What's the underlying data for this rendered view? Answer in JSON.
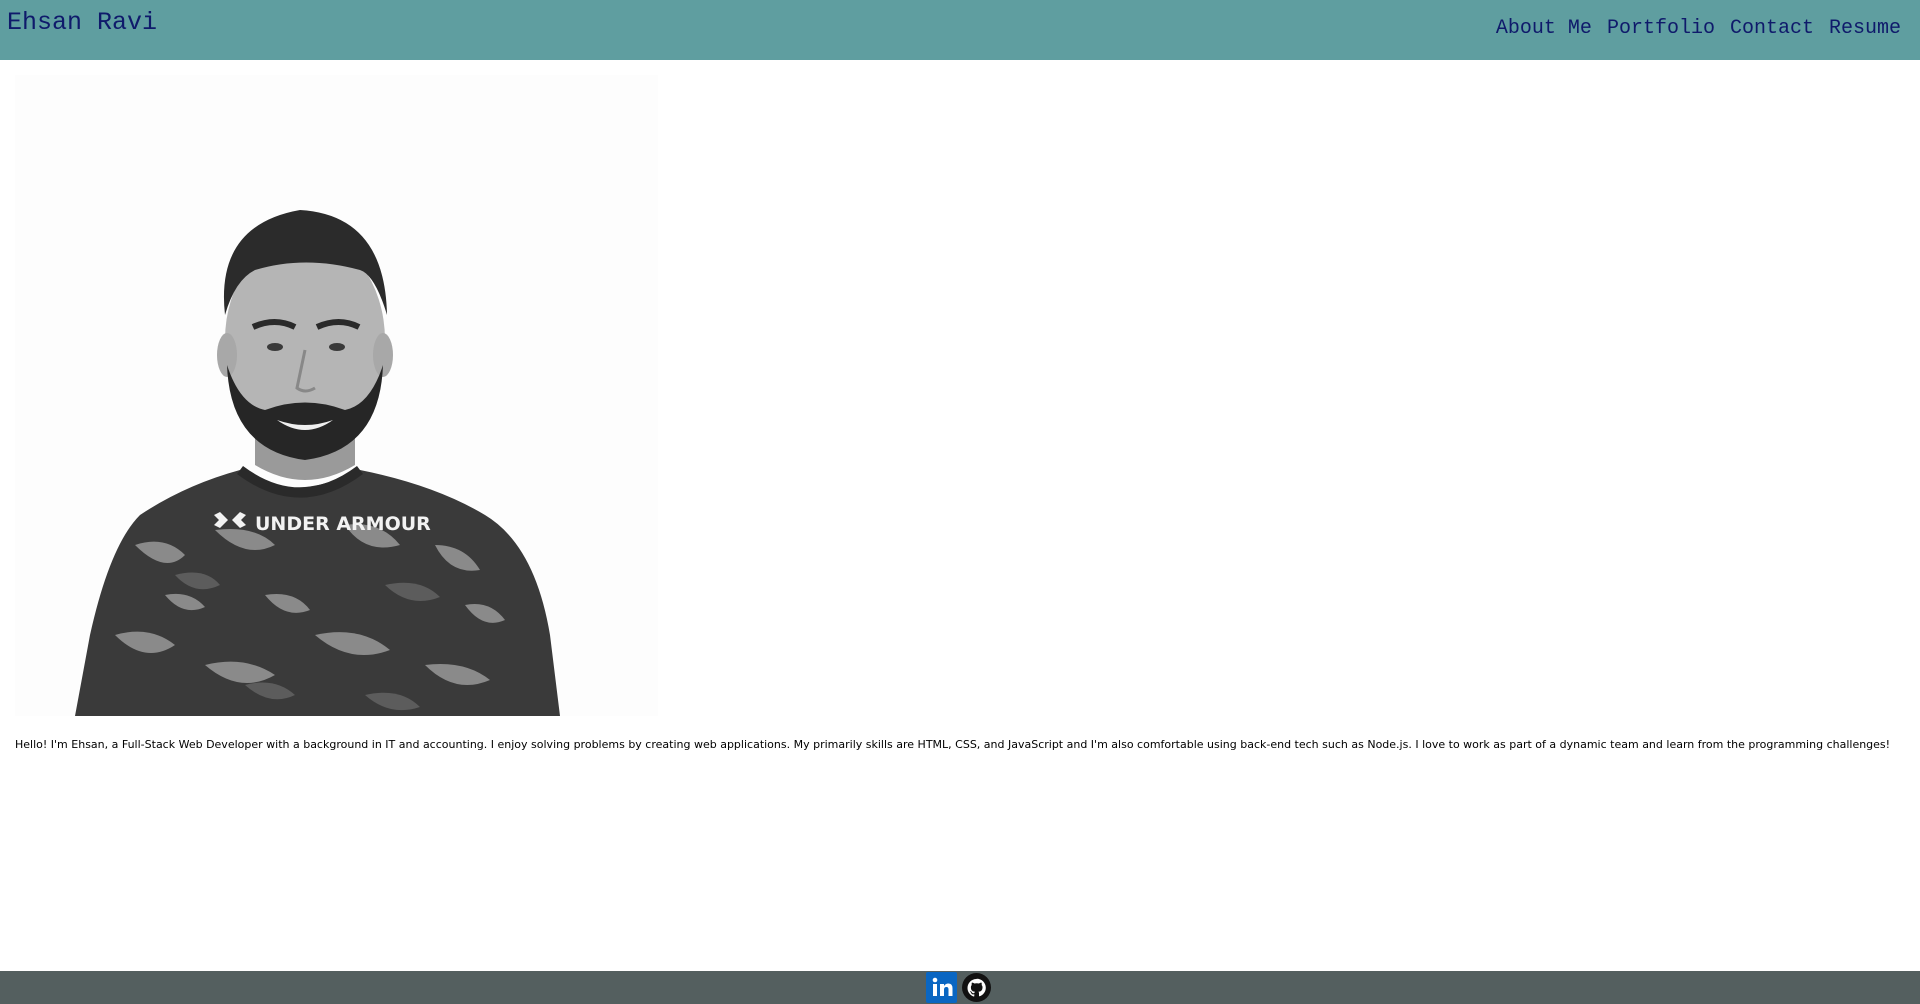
{
  "header": {
    "title": "Ehsan Ravi",
    "nav": [
      {
        "label": "About Me"
      },
      {
        "label": "Portfolio"
      },
      {
        "label": "Contact"
      },
      {
        "label": "Resume"
      }
    ]
  },
  "main": {
    "portrait": {
      "shirt_text": "UNDER ARMOUR"
    },
    "bio": "Hello! I'm Ehsan, a Full-Stack Web Developer with a background in IT and accounting. I enjoy solving problems by creating web applications. My primarily skills are HTML, CSS, and JavaScript and I'm also comfortable using back-end tech such as Node.js. I love to work as part of a dynamic team and learn from the programming challenges!"
  },
  "footer": {
    "icons": [
      {
        "icon": "linkedin-icon",
        "color": "#0a66c2"
      },
      {
        "icon": "github-icon",
        "color": "#111111"
      }
    ]
  },
  "colors": {
    "header_bg": "#5f9ea0",
    "nav_text": "#0f1a6b",
    "footer_bg": "#545f5f"
  }
}
